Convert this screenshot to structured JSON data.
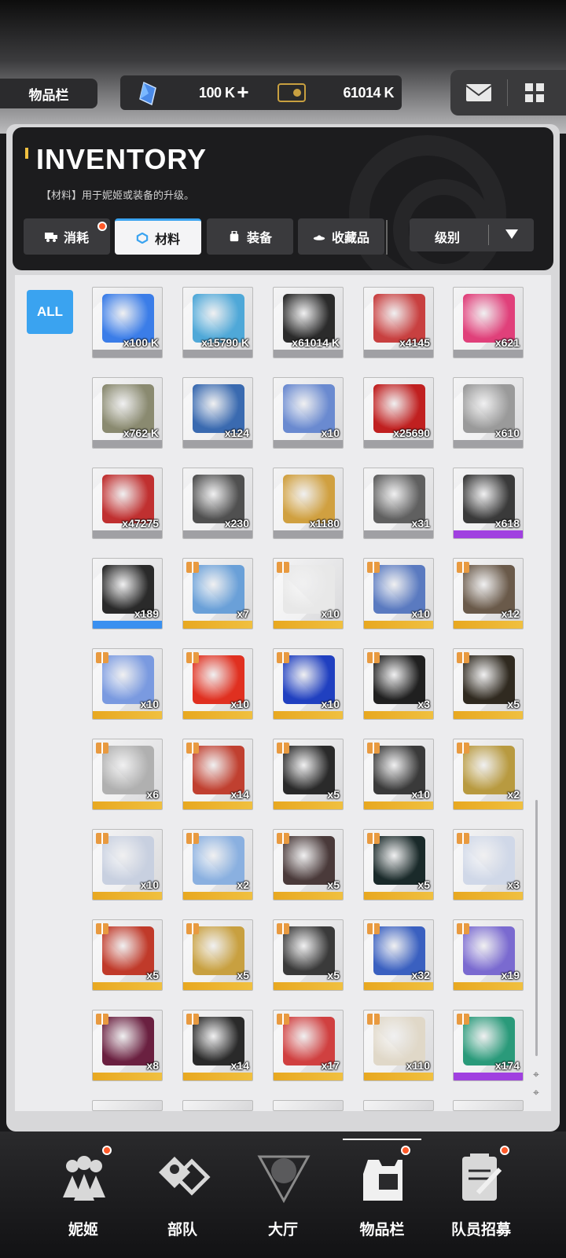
{
  "header": {
    "page_tab": "物品栏",
    "currency_1": {
      "icon": "crystal-icon",
      "value": "100 K",
      "plus": "+"
    },
    "currency_2": {
      "icon": "ticket-icon",
      "value": "61014 K"
    }
  },
  "panel": {
    "title": "INVENTORY",
    "description": "【材料】用于妮姬或装备的升级。",
    "tabs": [
      {
        "label": "消耗",
        "icon": "truck-icon",
        "badge": true
      },
      {
        "label": "材料",
        "icon": "hexagon-icon",
        "active": true
      },
      {
        "label": "装备",
        "icon": "backpack-icon"
      },
      {
        "label": "收藏品",
        "icon": "collectible-icon"
      }
    ],
    "sort": {
      "label": "级别"
    },
    "filter_all": "ALL"
  },
  "items": [
    {
      "qty": "x100 K",
      "rarity": "gray",
      "color": "#3b7de8",
      "gift": false
    },
    {
      "qty": "x15790 K",
      "rarity": "gray",
      "color": "#4fa8d8",
      "gift": false
    },
    {
      "qty": "x61014 K",
      "rarity": "gray",
      "color": "#2b2b2b",
      "gift": false
    },
    {
      "qty": "x4145",
      "rarity": "gray",
      "color": "#c84040",
      "gift": false
    },
    {
      "qty": "x621",
      "rarity": "gray",
      "color": "#e0407a",
      "gift": false
    },
    {
      "qty": "x762 K",
      "rarity": "gray",
      "color": "#8a8a70",
      "gift": false
    },
    {
      "qty": "x124",
      "rarity": "gray",
      "color": "#3a6ab0",
      "gift": false
    },
    {
      "qty": "x10",
      "rarity": "gray",
      "color": "#6a8ad0",
      "gift": false
    },
    {
      "qty": "x25690",
      "rarity": "gray",
      "color": "#c02020",
      "gift": false
    },
    {
      "qty": "x610",
      "rarity": "gray",
      "color": "#9a9a9a",
      "gift": false
    },
    {
      "qty": "x47275",
      "rarity": "gray",
      "color": "#c03030",
      "gift": false
    },
    {
      "qty": "x230",
      "rarity": "gray",
      "color": "#505050",
      "gift": false
    },
    {
      "qty": "x1180",
      "rarity": "gray",
      "color": "#d0a040",
      "gift": false
    },
    {
      "qty": "x31",
      "rarity": "gray",
      "color": "#606060",
      "gift": false
    },
    {
      "qty": "x618",
      "rarity": "purple",
      "color": "#3a3a3a",
      "gift": false
    },
    {
      "qty": "x189",
      "rarity": "blue",
      "color": "#2a2a2a",
      "gift": false
    },
    {
      "qty": "x7",
      "rarity": "gold",
      "color": "#6aa0d8",
      "gift": true
    },
    {
      "qty": "x10",
      "rarity": "gold",
      "color": "#e8e8e8",
      "gift": true
    },
    {
      "qty": "x10",
      "rarity": "gold",
      "color": "#5a7ac0",
      "gift": true
    },
    {
      "qty": "x12",
      "rarity": "gold",
      "color": "#6a5a4a",
      "gift": true
    },
    {
      "qty": "x10",
      "rarity": "gold",
      "color": "#7a9ae0",
      "gift": true
    },
    {
      "qty": "x10",
      "rarity": "gold",
      "color": "#e03020",
      "gift": true
    },
    {
      "qty": "x10",
      "rarity": "gold",
      "color": "#2040c0",
      "gift": true
    },
    {
      "qty": "x3",
      "rarity": "gold",
      "color": "#202020",
      "gift": true
    },
    {
      "qty": "x5",
      "rarity": "gold",
      "color": "#302a20",
      "gift": true
    },
    {
      "qty": "x6",
      "rarity": "gold",
      "color": "#b0b0b0",
      "gift": true
    },
    {
      "qty": "x14",
      "rarity": "gold",
      "color": "#c04030",
      "gift": true
    },
    {
      "qty": "x5",
      "rarity": "gold",
      "color": "#2a2a2a",
      "gift": true
    },
    {
      "qty": "x10",
      "rarity": "gold",
      "color": "#3a3a3a",
      "gift": true
    },
    {
      "qty": "x2",
      "rarity": "gold",
      "color": "#b89a40",
      "gift": true
    },
    {
      "qty": "x10",
      "rarity": "gold",
      "color": "#c8d0e0",
      "gift": true
    },
    {
      "qty": "x2",
      "rarity": "gold",
      "color": "#8ab0e0",
      "gift": true
    },
    {
      "qty": "x5",
      "rarity": "gold",
      "color": "#4a3a3a",
      "gift": true
    },
    {
      "qty": "x5",
      "rarity": "gold",
      "color": "#1a2a2a",
      "gift": true
    },
    {
      "qty": "x3",
      "rarity": "gold",
      "color": "#d0d8e8",
      "gift": true
    },
    {
      "qty": "x5",
      "rarity": "gold",
      "color": "#c03a2a",
      "gift": true
    },
    {
      "qty": "x5",
      "rarity": "gold",
      "color": "#c8a040",
      "gift": true
    },
    {
      "qty": "x5",
      "rarity": "gold",
      "color": "#3a3a3a",
      "gift": true
    },
    {
      "qty": "x32",
      "rarity": "gold",
      "color": "#3a60c0",
      "gift": true
    },
    {
      "qty": "x19",
      "rarity": "gold",
      "color": "#7a6ad0",
      "gift": true
    },
    {
      "qty": "x8",
      "rarity": "gold",
      "color": "#6a2040",
      "gift": true
    },
    {
      "qty": "x14",
      "rarity": "gold",
      "color": "#2a2a2a",
      "gift": true
    },
    {
      "qty": "x17",
      "rarity": "gold",
      "color": "#d04040",
      "gift": true
    },
    {
      "qty": "x110",
      "rarity": "gold",
      "color": "#e0d8c8",
      "gift": true
    },
    {
      "qty": "x174",
      "rarity": "purple",
      "color": "#2a9a7a",
      "gift": true
    }
  ],
  "nav": [
    {
      "label": "妮姬",
      "icon": "nikke-icon",
      "badge": true
    },
    {
      "label": "部队",
      "icon": "squad-icon",
      "badge": false
    },
    {
      "label": "大厅",
      "icon": "lobby-icon",
      "badge": false
    },
    {
      "label": "物品栏",
      "icon": "inventory-icon",
      "badge": true,
      "active": true
    },
    {
      "label": "队员招募",
      "icon": "recruit-icon",
      "badge": true
    }
  ]
}
